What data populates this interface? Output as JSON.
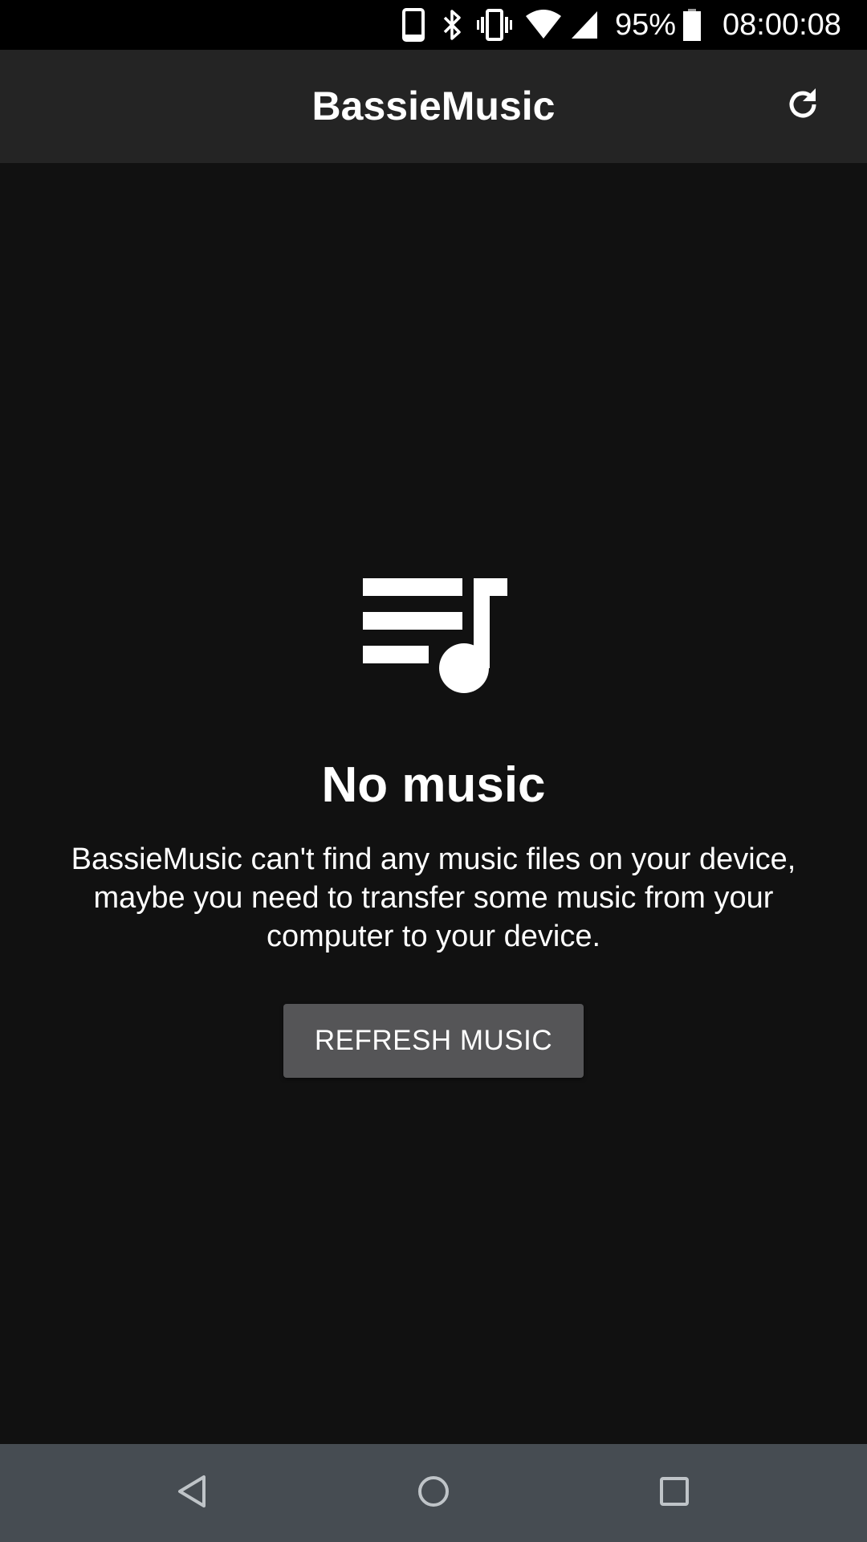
{
  "status_bar": {
    "battery_percent": "95%",
    "time": "08:00:08",
    "icons": [
      "phone-icon",
      "bluetooth-icon",
      "vibrate-icon",
      "wifi-icon",
      "signal-icon",
      "battery-icon"
    ]
  },
  "app_bar": {
    "title": "BassieMusic",
    "action_icon": "refresh-icon"
  },
  "empty_state": {
    "icon": "playlist-music-icon",
    "title": "No music",
    "message": "BassieMusic can't find any music files on your device, maybe you need to transfer some music from your computer to your device.",
    "button_label": "REFRESH MUSIC"
  },
  "nav_bar": {
    "buttons": [
      "back-icon",
      "home-icon",
      "recents-icon"
    ]
  },
  "colors": {
    "background": "#111111",
    "app_bar": "#242424",
    "status_bar": "#000000",
    "button": "#555557",
    "nav_bar": "#464c52",
    "text": "#ffffff"
  }
}
